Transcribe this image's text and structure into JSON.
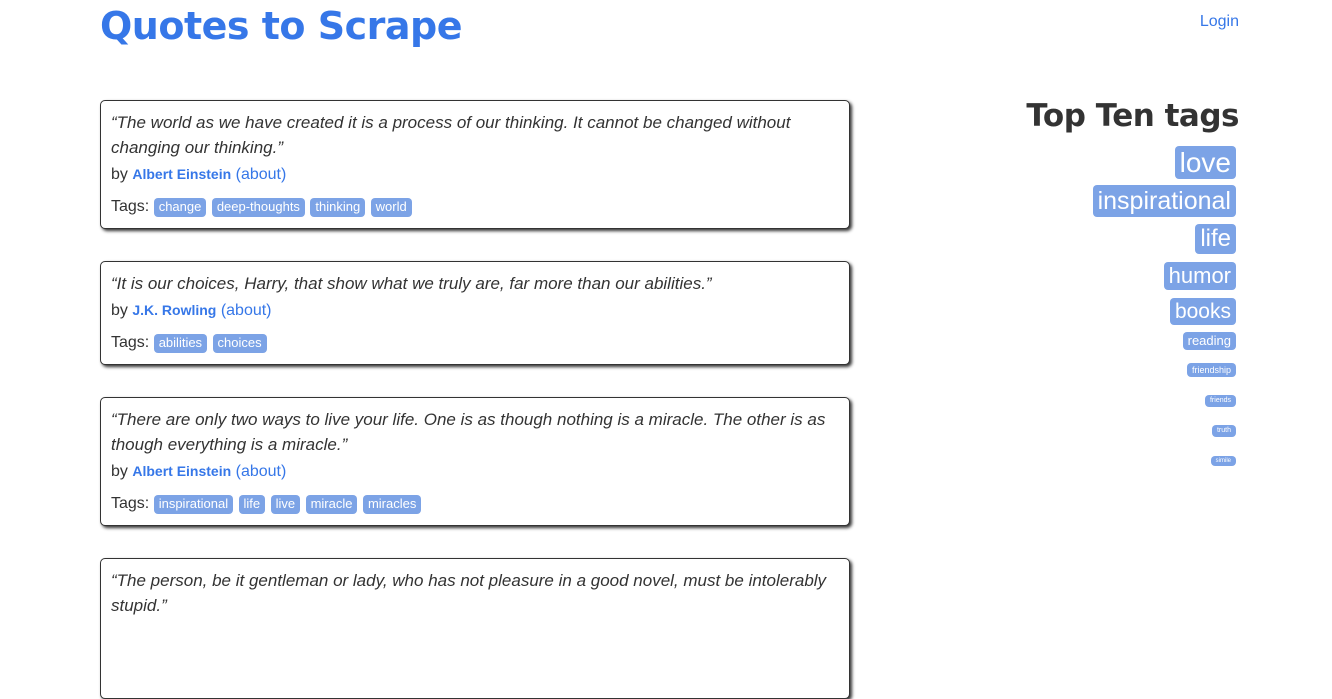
{
  "header": {
    "title": "Quotes to Scrape",
    "login": "Login"
  },
  "quotes": [
    {
      "text": "“The world as we have created it is a process of our thinking. It cannot be changed without changing our thinking.”",
      "by": "by",
      "author": "Albert Einstein",
      "about": "(about)",
      "tags_label": "Tags:",
      "tags": [
        "change",
        "deep-thoughts",
        "thinking",
        "world"
      ]
    },
    {
      "text": "“It is our choices, Harry, that show what we truly are, far more than our abilities.”",
      "by": "by",
      "author": "J.K. Rowling",
      "about": "(about)",
      "tags_label": "Tags:",
      "tags": [
        "abilities",
        "choices"
      ]
    },
    {
      "text": "“There are only two ways to live your life. One is as though nothing is a miracle. The other is as though everything is a miracle.”",
      "by": "by",
      "author": "Albert Einstein",
      "about": "(about)",
      "tags_label": "Tags:",
      "tags": [
        "inspirational",
        "life",
        "live",
        "miracle",
        "miracles"
      ]
    },
    {
      "text": "“The person, be it gentleman or lady, who has not pleasure in a good novel, must be intolerably stupid.”",
      "by": "",
      "author": "",
      "about": "",
      "tags_label": "",
      "tags": []
    }
  ],
  "sidebar": {
    "heading": "Top Ten tags",
    "tags": [
      "love",
      "inspirational",
      "life",
      "humor",
      "books",
      "reading",
      "friendship",
      "friends",
      "truth",
      "simile"
    ]
  },
  "colors": {
    "accent": "#3677e8",
    "tag_bg": "#7ca3e6"
  }
}
